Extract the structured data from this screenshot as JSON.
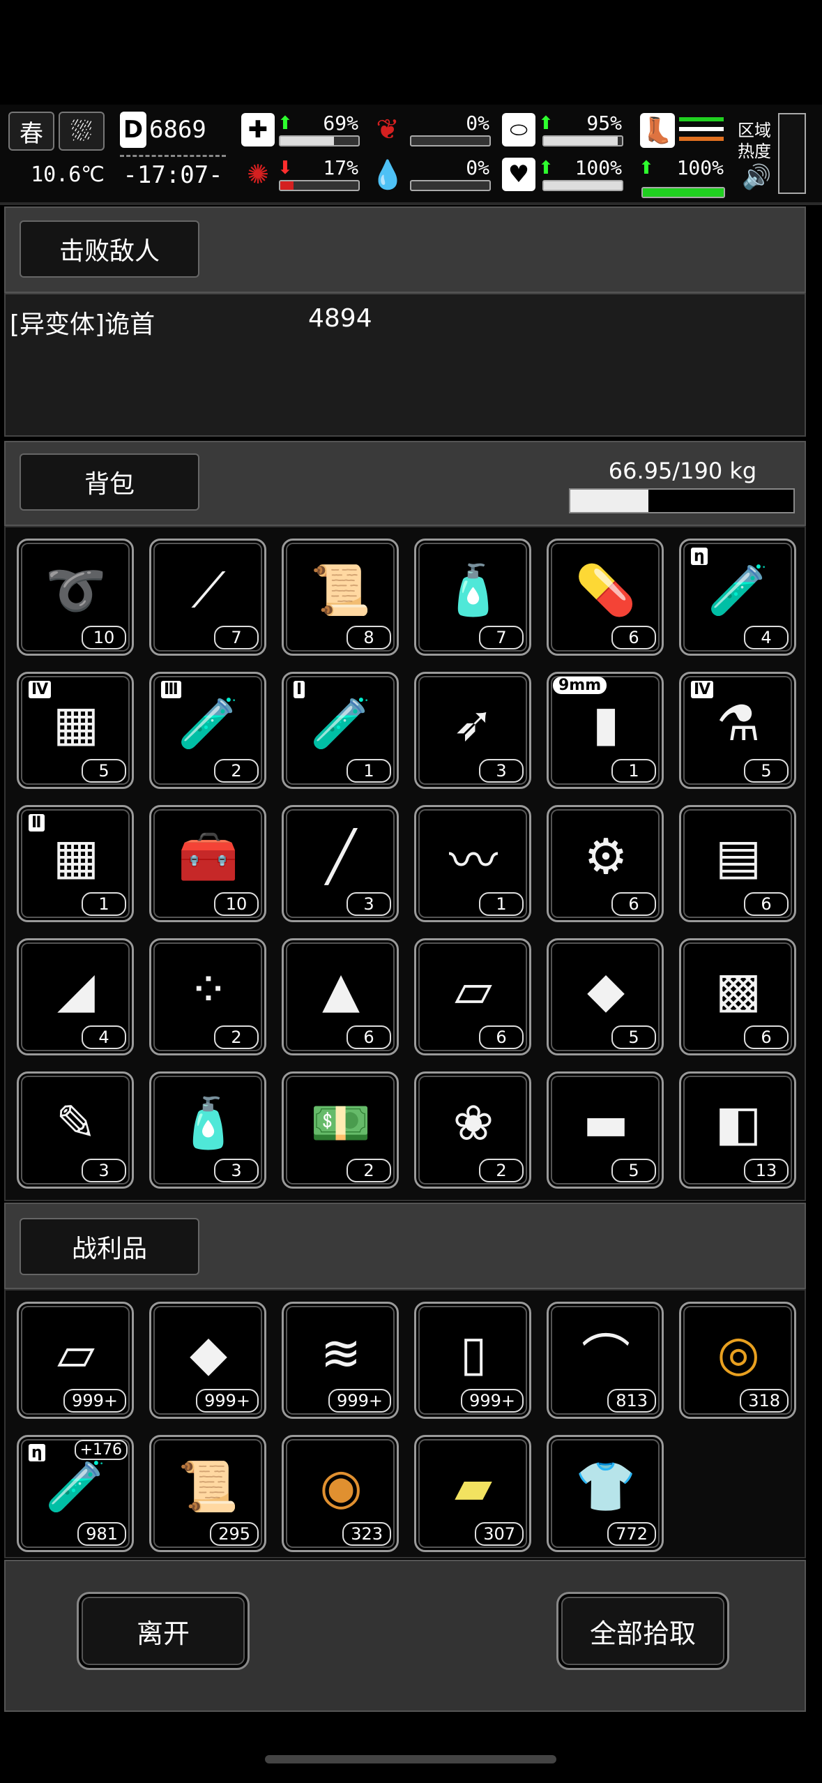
{
  "status": {
    "season": "春",
    "temperature": "10.6℃",
    "day_letter": "D",
    "days": "6869",
    "time": "-17:07-",
    "health": {
      "value": "69%",
      "level": 0.69,
      "trend": "up"
    },
    "hunger": {
      "value": "0%",
      "level": 0.0
    },
    "stamina": {
      "value": "95%",
      "level": 0.95,
      "trend": "up"
    },
    "infection": {
      "value": "17%",
      "level": 0.17,
      "trend": "down"
    },
    "bleeding": {
      "value": "0%",
      "level": 0.0
    },
    "mood": {
      "value": "100%",
      "level": 1.0,
      "trend": "up"
    },
    "speed": {
      "value": "100%",
      "level": 1.0,
      "trend": "up"
    },
    "region_label": "区域\n热度"
  },
  "defeat": {
    "button": "击败敌人",
    "enemy_name": "[异变体]诡首",
    "enemy_value": "4894"
  },
  "backpack": {
    "button": "背包",
    "weight": "66.95/190 kg",
    "weight_fraction": 0.35,
    "items": [
      {
        "icon": "rope-icon",
        "glyph": "➰",
        "qty": "10"
      },
      {
        "icon": "lockpick-icon",
        "glyph": "⟋",
        "qty": "7"
      },
      {
        "icon": "paper-roll-icon",
        "glyph": "📜",
        "qty": "8"
      },
      {
        "icon": "bottles-icon",
        "glyph": "🧴",
        "qty": "7"
      },
      {
        "icon": "pill-bottle-icon",
        "glyph": "💊",
        "qty": "6"
      },
      {
        "icon": "test-tube-purple-icon",
        "glyph": "🧪",
        "qty": "4",
        "color": "#9b3fb5",
        "tier": "η"
      },
      {
        "icon": "circuit-chip-icon",
        "glyph": "▦",
        "qty": "5",
        "tier": "Ⅳ"
      },
      {
        "icon": "test-tube-icon",
        "glyph": "🧪",
        "qty": "2",
        "tier": "Ⅲ"
      },
      {
        "icon": "test-tube-icon",
        "glyph": "🧪",
        "qty": "1",
        "tier": "Ⅰ"
      },
      {
        "icon": "arrow-icon",
        "glyph": "➶",
        "qty": "3"
      },
      {
        "icon": "bullet-icon",
        "glyph": "▮",
        "qty": "1",
        "tag": "9mm"
      },
      {
        "icon": "lab-flask-icon",
        "glyph": "⚗",
        "qty": "5",
        "tier": "Ⅳ"
      },
      {
        "icon": "blueprint-icon",
        "glyph": "▦",
        "qty": "1",
        "tier": "Ⅱ"
      },
      {
        "icon": "toolbox-icon",
        "glyph": "🧰",
        "qty": "10"
      },
      {
        "icon": "cigarette-icon",
        "glyph": "╱",
        "qty": "3"
      },
      {
        "icon": "spring-icon",
        "glyph": "〰",
        "qty": "1"
      },
      {
        "icon": "scrap-metal-icon",
        "glyph": "⚙",
        "qty": "6"
      },
      {
        "icon": "planks-icon",
        "glyph": "▤",
        "qty": "6"
      },
      {
        "icon": "tusk-icon",
        "glyph": "◢",
        "qty": "4"
      },
      {
        "icon": "beads-icon",
        "glyph": "⁘",
        "qty": "2"
      },
      {
        "icon": "fang-icon",
        "glyph": "▲",
        "qty": "6"
      },
      {
        "icon": "cloth-icon",
        "glyph": "▱",
        "qty": "6"
      },
      {
        "icon": "hide-icon",
        "glyph": "◆",
        "qty": "5"
      },
      {
        "icon": "wood-block-icon",
        "glyph": "▩",
        "qty": "6"
      },
      {
        "icon": "torch-tool-icon",
        "glyph": "✎",
        "qty": "3"
      },
      {
        "icon": "spray-bottle-icon",
        "glyph": "🧴",
        "qty": "3"
      },
      {
        "icon": "cash-stack-icon",
        "glyph": "💵",
        "qty": "2"
      },
      {
        "icon": "cotton-balls-icon",
        "glyph": "❀",
        "qty": "2"
      },
      {
        "icon": "bar-icon",
        "glyph": "▬",
        "qty": "5"
      },
      {
        "icon": "tape-icon",
        "glyph": "◧",
        "qty": "13"
      }
    ]
  },
  "loot": {
    "button": "战利品",
    "items": [
      {
        "icon": "cloth-icon",
        "glyph": "▱",
        "qty": "999+"
      },
      {
        "icon": "hide-icon",
        "glyph": "◆",
        "qty": "999+"
      },
      {
        "icon": "towel-icon",
        "glyph": "≋",
        "qty": "999+"
      },
      {
        "icon": "paper-sheet-icon",
        "glyph": "▯",
        "qty": "999+"
      },
      {
        "icon": "folded-cloth-icon",
        "glyph": "⌒",
        "qty": "813"
      },
      {
        "icon": "gold-thread-spool-icon",
        "glyph": "◎",
        "qty": "318",
        "color": "#e8a020"
      },
      {
        "icon": "test-tube-purple-icon",
        "glyph": "🧪",
        "qty": "981",
        "color": "#9b3fb5",
        "tier": "η",
        "plus": "+176"
      },
      {
        "icon": "paper-roll-icon",
        "glyph": "📜",
        "qty": "295"
      },
      {
        "icon": "leather-roll-icon",
        "glyph": "◉",
        "qty": "323",
        "color": "#e09030"
      },
      {
        "icon": "yellow-fabric-icon",
        "glyph": "▰",
        "qty": "307",
        "color": "#f2e260"
      },
      {
        "icon": "torn-shirt-icon",
        "glyph": "👕",
        "qty": "772"
      }
    ]
  },
  "actions": {
    "leave": "离开",
    "take_all": "全部拾取"
  }
}
